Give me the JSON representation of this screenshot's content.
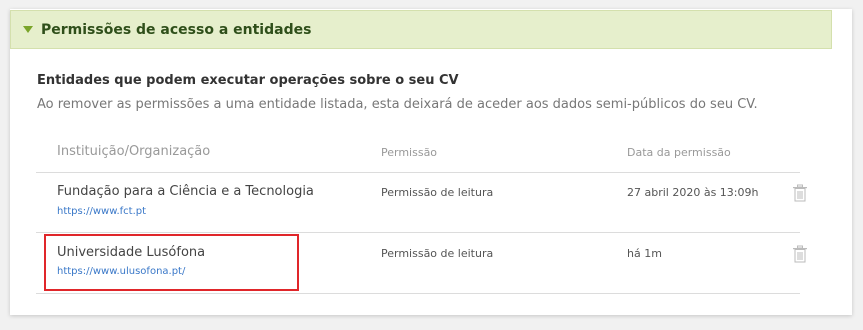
{
  "section": {
    "title": "Permissões de acesso a entidades"
  },
  "content": {
    "subtitle": "Entidades que podem executar operações sobre o seu CV",
    "description": "Ao remover as permissões a uma entidade listada, esta deixará de aceder aos dados semi-públicos do seu CV."
  },
  "table": {
    "columns": {
      "institution": "Instituição/Organização",
      "permission": "Permissão",
      "date": "Data da permissão"
    },
    "rows": [
      {
        "name": "Fundação para a Ciência e a Tecnologia",
        "url": "https://www.fct.pt",
        "permission": "Permissão de leitura",
        "date": "27 abril 2020 às 13:09h",
        "delete_icon": "trash-icon"
      },
      {
        "name": "Universidade Lusófona",
        "url": "https://www.ulusofona.pt/",
        "permission": "Permissão de leitura",
        "date": "há 1m",
        "delete_icon": "trash-icon"
      }
    ]
  },
  "colors": {
    "header_bg": "#e6efcc",
    "accent_green": "#7aa52a",
    "link_blue": "#3a78c8",
    "highlight_red": "#e0262a"
  }
}
